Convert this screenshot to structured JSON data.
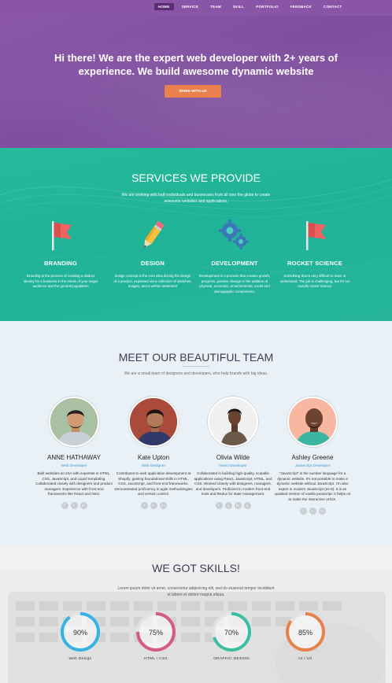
{
  "nav": {
    "links": [
      "HOME",
      "SERVICE",
      "TEAM",
      "SKILL",
      "PORTFOLIO",
      "FEEDBACK",
      "CONTACT"
    ],
    "active": "HOME"
  },
  "hero": {
    "title": "Hi there! We are the expert web developer with 2+ years of experience. We build awesome dynamic website",
    "button": "WORK WITH US"
  },
  "services": {
    "title": "SERVICES WE PROVIDE",
    "subtitle": "We are working with both individuals and businesses from all over the globe to create awesome websites and applications.",
    "items": [
      {
        "name": "BRANDING",
        "icon": "flag-icon",
        "desc": "Branding is the process of creating a distinct identity for a business in the minds of your target audience and the general population"
      },
      {
        "name": "DESIGN",
        "icon": "pencil-icon",
        "desc": "design concept is the core idea driving the design of a product, explained via a collection of sketches, images, and a written statement"
      },
      {
        "name": "DEVELOPMENT",
        "icon": "gears-icon",
        "desc": "Development is a process that creates growth, progress, positive change or the addition of physical, economic, environmental, social and demographic components."
      },
      {
        "name": "ROCKET SCIENCE",
        "icon": "flag-icon",
        "desc": "Something that is very difficult to learn or understand. The job is challenging, but it's not exactly rocket science"
      }
    ]
  },
  "team": {
    "title": "MEET OUR BEAUTIFUL TEAM",
    "subtitle": "We are a small team of designers and developers, who help brands with big ideas.",
    "members": [
      {
        "name": "ANNE HATHAWAY",
        "role": "Web Developer",
        "desc": "Built websites at USA with expertise in HTML, CSS, JavaScript, and Liquid templating. Collaborated closely with designers and product managers. Experience with front-end frameworks like React and Next."
      },
      {
        "name": "Kate Upton",
        "role": "Web Designer",
        "desc": "Contributed to web application development at Shopify, gaining foundational skills in HTML, CSS, JavaScript, and front-end frameworks. Demonstrated proficiency in agile methodologies and version control."
      },
      {
        "name": "Olivia Wilde",
        "role": "React Developer",
        "desc": "Collaborated in building high-quality, scalable applications using React, JavaScript, HTML, and CSS. Worked closely with designers, managers, and developers. Proficient in modern front-end tools and Redux for state management."
      },
      {
        "name": "Ashley Greene",
        "role": "Javascript Developer",
        "desc": "\"JavaScript\" is the number language for a dynamic website. It's not possible to make a dynamic website without JavaScript. I'm also expert in modern JavaScript (es-6). It is an updated version of vanilla javascript. It helps us to make the interactive UI/UX."
      }
    ],
    "social_icons": [
      "facebook-icon",
      "twitter-icon",
      "linkedin-icon"
    ]
  },
  "skills": {
    "title": "WE GOT SKILLS!",
    "subtitle": "Lorem ipsum dolor sit amet, consectetur adipisicing elit, sed do eiusmod tempor incididunt ut labore et dolore magna aliqua.",
    "items": [
      {
        "label": "Web Design",
        "value": "90%",
        "fraction": 0.9,
        "color": "#35b4e3"
      },
      {
        "label": "HTML / CSS",
        "value": "75%",
        "fraction": 0.75,
        "color": "#d45a87"
      },
      {
        "label": "GRAPHIC DESIGN",
        "value": "70%",
        "fraction": 0.7,
        "color": "#3bbfa4"
      },
      {
        "label": "UI / UX",
        "value": "85%",
        "fraction": 0.85,
        "color": "#e8824d"
      }
    ]
  },
  "colors": {
    "hero": "#8a55a6",
    "nav_active": "#5b2c74",
    "accent_button": "#e9804d",
    "services_bg": "#22b598",
    "team_bg": "#e9f1f6"
  }
}
